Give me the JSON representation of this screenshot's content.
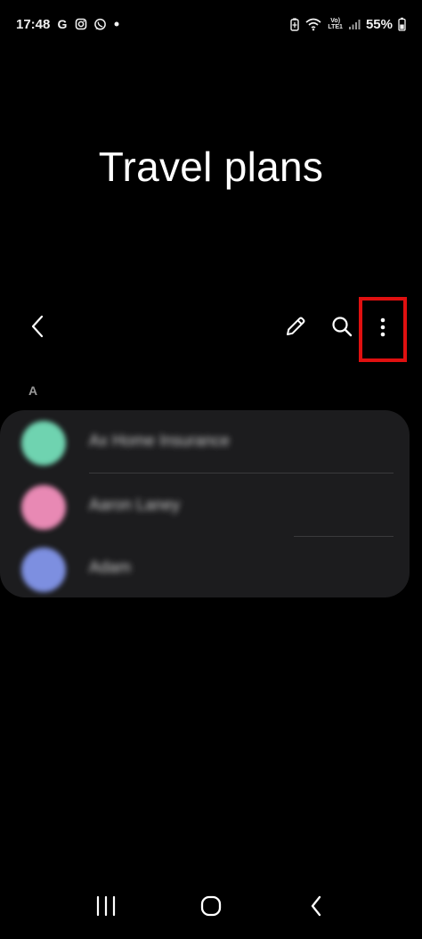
{
  "status_bar": {
    "time": "17:48",
    "volte_top": "Vo)",
    "volte_bottom": "LTE1",
    "battery_pct": "55%"
  },
  "header": {
    "title": "Travel plans"
  },
  "toolbar": {
    "icons": [
      "back-icon",
      "pencil-icon",
      "search-icon",
      "more-vert-icon"
    ],
    "highlight_color": "#e01010"
  },
  "contacts": {
    "section_letter": "A",
    "items": [
      {
        "name": "Ax Home Insurance",
        "avatar_color": "#6fd3b0"
      },
      {
        "name": "Aaron Laney",
        "avatar_color": "#e889b4"
      },
      {
        "name": "Adam",
        "avatar_color": "#7d8fe0"
      }
    ]
  },
  "nav_bar": {
    "icons": [
      "recents-icon",
      "home-icon",
      "back-nav-icon"
    ]
  }
}
